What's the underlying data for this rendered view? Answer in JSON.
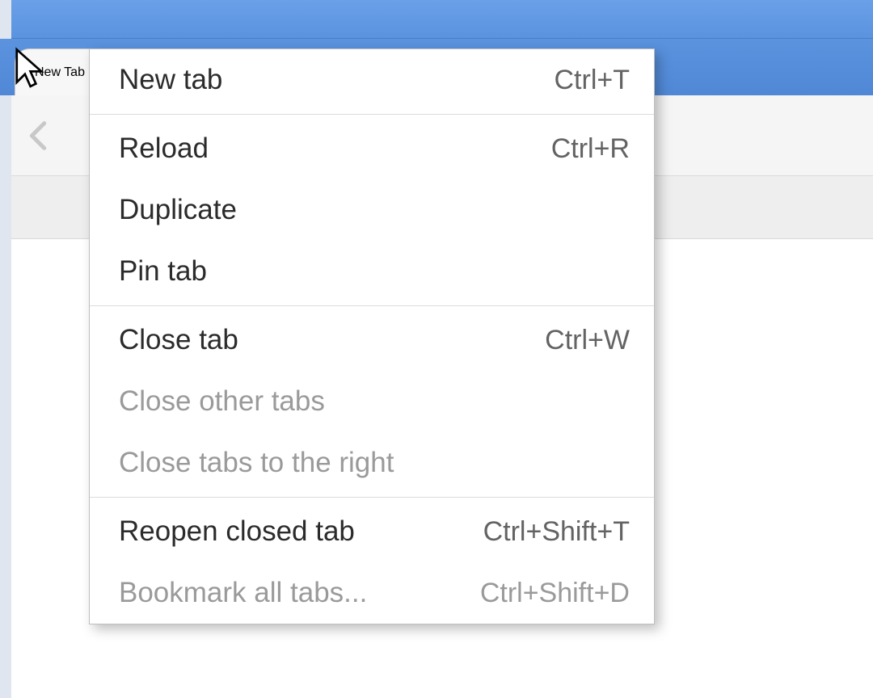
{
  "tab": {
    "title": "New Tab"
  },
  "context_menu": {
    "groups": [
      [
        {
          "label": "New tab",
          "shortcut": "Ctrl+T",
          "enabled": true
        }
      ],
      [
        {
          "label": "Reload",
          "shortcut": "Ctrl+R",
          "enabled": true
        },
        {
          "label": "Duplicate",
          "shortcut": "",
          "enabled": true
        },
        {
          "label": "Pin tab",
          "shortcut": "",
          "enabled": true
        }
      ],
      [
        {
          "label": "Close tab",
          "shortcut": "Ctrl+W",
          "enabled": true
        },
        {
          "label": "Close other tabs",
          "shortcut": "",
          "enabled": false
        },
        {
          "label": "Close tabs to the right",
          "shortcut": "",
          "enabled": false
        }
      ],
      [
        {
          "label": "Reopen closed tab",
          "shortcut": "Ctrl+Shift+T",
          "enabled": true
        },
        {
          "label": "Bookmark all tabs...",
          "shortcut": "Ctrl+Shift+D",
          "enabled": false
        }
      ]
    ]
  }
}
